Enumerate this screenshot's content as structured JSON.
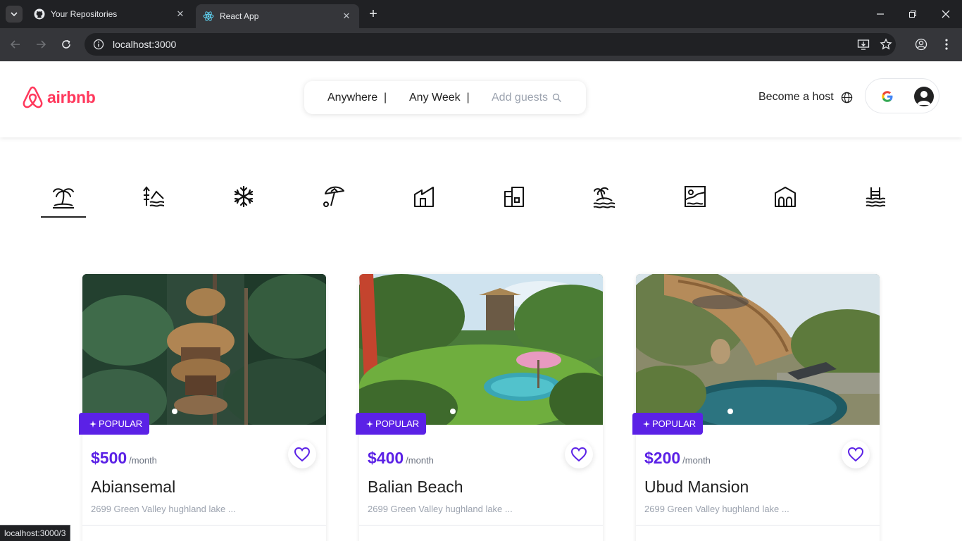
{
  "browser": {
    "tabs": [
      {
        "title": "Your Repositories",
        "active": false
      },
      {
        "title": "React App",
        "active": true
      }
    ],
    "url": "localhost:3000",
    "status_url": "localhost:3000/3"
  },
  "header": {
    "logo_text": "airbnb",
    "search": {
      "where": "Anywhere",
      "when": "Any Week",
      "guests_placeholder": "Add guests"
    },
    "host_label": "Become a host"
  },
  "categories": [
    {
      "icon": "palm-tree-icon",
      "active": true
    },
    {
      "icon": "surfing-icon",
      "active": false
    },
    {
      "icon": "snowflake-icon",
      "active": false
    },
    {
      "icon": "beach-umbrella-icon",
      "active": false
    },
    {
      "icon": "tiny-home-icon",
      "active": false
    },
    {
      "icon": "countryside-house-icon",
      "active": false
    },
    {
      "icon": "island-icon",
      "active": false
    },
    {
      "icon": "lake-view-icon",
      "active": false
    },
    {
      "icon": "cabin-icon",
      "active": false
    },
    {
      "icon": "waves-icon",
      "active": false
    }
  ],
  "listings": [
    {
      "badge": "POPULAR",
      "price": "$500",
      "period": "/month",
      "name": "Abiansemal",
      "address": "2699 Green Valley hughland lake ..."
    },
    {
      "badge": "POPULAR",
      "price": "$400",
      "period": "/month",
      "name": "Balian Beach",
      "address": "2699 Green Valley hughland lake ..."
    },
    {
      "badge": "POPULAR",
      "price": "$200",
      "period": "/month",
      "name": "Ubud Mansion",
      "address": "2699 Green Valley hughland lake ..."
    }
  ],
  "colors": {
    "brand": "#FF385C",
    "accent": "#5b21e6"
  }
}
